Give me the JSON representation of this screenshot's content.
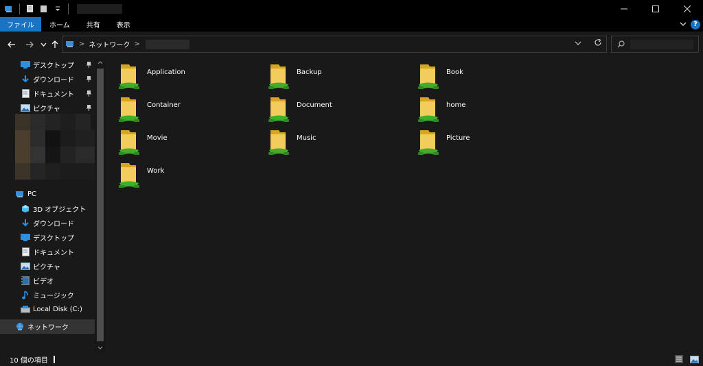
{
  "ribbon": {
    "file": "ファイル",
    "home": "ホーム",
    "share": "共有",
    "view": "表示"
  },
  "address": {
    "root": "ネットワーク",
    "separator": ">"
  },
  "nav": {
    "quick_access": [
      {
        "label": "デスクトップ",
        "icon": "desktop-icon",
        "pinned": true
      },
      {
        "label": "ダウンロード",
        "icon": "download-icon",
        "pinned": true
      },
      {
        "label": "ドキュメント",
        "icon": "document-icon",
        "pinned": true
      },
      {
        "label": "ピクチャ",
        "icon": "picture-icon",
        "pinned": true
      }
    ],
    "pc": {
      "label": "PC",
      "icon": "pc-icon"
    },
    "pc_items": [
      {
        "label": "3D オブジェクト",
        "icon": "3d-objects-icon"
      },
      {
        "label": "ダウンロード",
        "icon": "download-icon"
      },
      {
        "label": "デスクトップ",
        "icon": "desktop-icon"
      },
      {
        "label": "ドキュメント",
        "icon": "document-icon"
      },
      {
        "label": "ピクチャ",
        "icon": "picture-icon"
      },
      {
        "label": "ビデオ",
        "icon": "video-icon"
      },
      {
        "label": "ミュージック",
        "icon": "music-icon"
      },
      {
        "label": "Local Disk (C:)",
        "icon": "drive-icon"
      }
    ],
    "network": {
      "label": "ネットワーク",
      "icon": "network-icon"
    }
  },
  "folders": [
    {
      "name": "Application"
    },
    {
      "name": "Backup"
    },
    {
      "name": "Book"
    },
    {
      "name": "Container"
    },
    {
      "name": "Document"
    },
    {
      "name": "home"
    },
    {
      "name": "Movie"
    },
    {
      "name": "Music"
    },
    {
      "name": "Picture"
    },
    {
      "name": "Work"
    }
  ],
  "status": {
    "item_count": "10 個の項目"
  },
  "colors": {
    "accent": "#1a74c4",
    "background": "#191919",
    "titlebar": "#000000",
    "folder_yellow": "#f3cd5b",
    "share_green": "#3fae2a"
  }
}
